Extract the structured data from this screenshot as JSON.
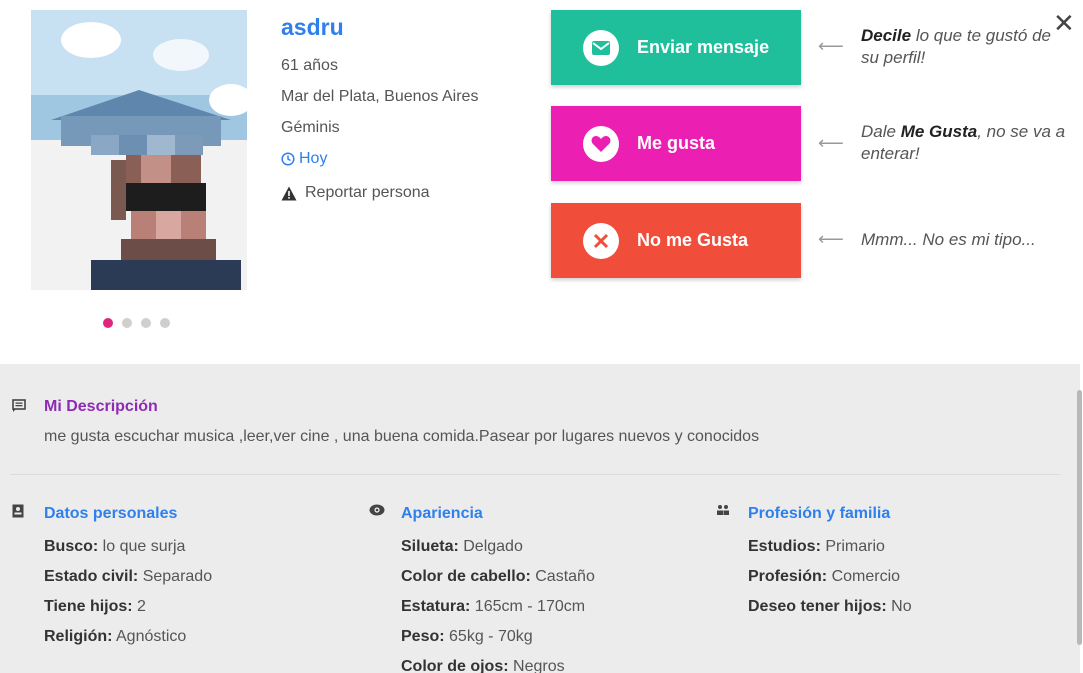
{
  "profile": {
    "name": "asdru",
    "age": "61 años",
    "location": "Mar del Plata, Buenos Aires",
    "sign": "Géminis",
    "last_seen": "Hoy",
    "report_label": "Reportar persona"
  },
  "photo_dots": {
    "count": 4,
    "active": 1
  },
  "actions": {
    "message": {
      "label": "Enviar mensaje",
      "color": "#1fbf9c"
    },
    "like": {
      "label": "Me gusta",
      "color": "#ec1fb3"
    },
    "dislike": {
      "label": "No me Gusta",
      "color": "#f04e3a"
    }
  },
  "hints": {
    "message": {
      "bold": "Decile",
      "rest": " lo que te gustó de su perfil!"
    },
    "like": {
      "pre": "Dale ",
      "bold": "Me Gusta",
      "rest": ", no se va a enterar!"
    },
    "dislike": {
      "text": "Mmm... No es mi tipo..."
    }
  },
  "description": {
    "title": "Mi Descripción",
    "text": "me gusta escuchar musica ,leer,ver cine , una buena comida.Pasear por lugares nuevos y conocidos"
  },
  "personal": {
    "title": "Datos personales",
    "rows": [
      {
        "k": "Busco:",
        "v": " lo que surja"
      },
      {
        "k": "Estado civil:",
        "v": " Separado"
      },
      {
        "k": "Tiene hijos:",
        "v": " 2"
      },
      {
        "k": "Religión:",
        "v": " Agnóstico"
      }
    ]
  },
  "appearance": {
    "title": "Apariencia",
    "rows": [
      {
        "k": "Silueta:",
        "v": " Delgado"
      },
      {
        "k": "Color de cabello:",
        "v": " Castaño"
      },
      {
        "k": "Estatura:",
        "v": " 165cm - 170cm"
      },
      {
        "k": "Peso:",
        "v": " 65kg - 70kg"
      },
      {
        "k": "Color de ojos:",
        "v": " Negros"
      }
    ]
  },
  "profession": {
    "title": "Profesión y familia",
    "rows": [
      {
        "k": "Estudios:",
        "v": " Primario"
      },
      {
        "k": "Profesión:",
        "v": " Comercio"
      },
      {
        "k": "Deseo tener hijos:",
        "v": " No"
      }
    ]
  },
  "colors": {
    "accent_blue": "#2f80ed",
    "accent_purple": "#8e2bb5",
    "active_dot": "#e0257f"
  }
}
